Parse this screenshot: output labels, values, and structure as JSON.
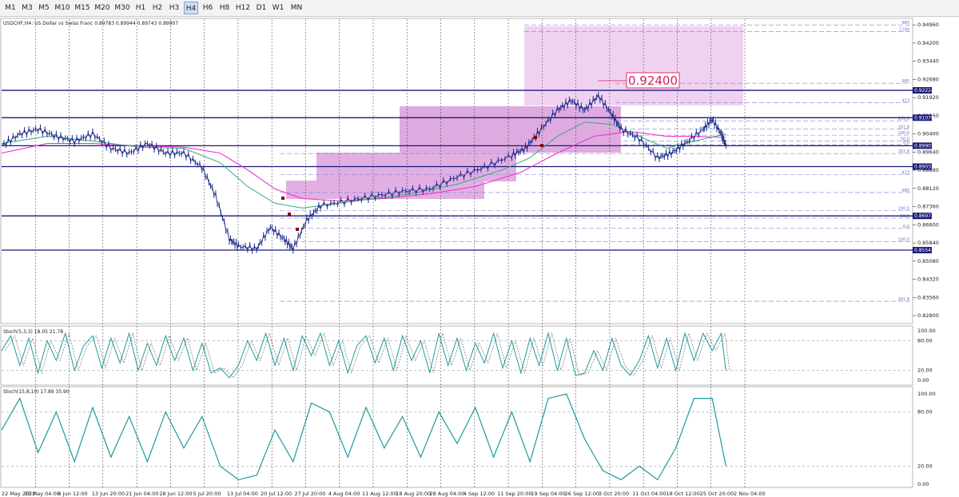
{
  "toolbar": {
    "timeframes": [
      "M1",
      "M3",
      "M5",
      "M10",
      "M15",
      "M20",
      "M30",
      "H1",
      "H2",
      "H3",
      "H4",
      "H6",
      "H8",
      "H12",
      "D1",
      "W1",
      "MN"
    ],
    "active": "H4"
  },
  "main_panel": {
    "header": "USDCHF,H4:  US Dollar vs Swiss Franc  0.89783 0.89944 0.89743 0.89907",
    "price_callout": "0.92400",
    "axis_labels": [
      "0.94960",
      "0.94200",
      "0.93440",
      "0.92680",
      "0.91920",
      "0.91160",
      "0.90400",
      "0.89640",
      "0.88880",
      "0.88120",
      "0.87360",
      "0.86600",
      "0.85840",
      "0.85080",
      "0.84320",
      "0.83560",
      "0.82800"
    ],
    "line_badges": [
      "0.92224",
      "0.91079",
      "0.89907",
      "0.89033",
      "0.86972",
      "0.85541"
    ],
    "fib_labels": [
      "685",
      "1100",
      "685",
      "423",
      "261.8",
      "161.8",
      "100.0",
      "50.0",
      "0.0",
      "261.8",
      "423",
      "685",
      "100.0",
      "50.0",
      "0.0",
      "100.0",
      "261.8"
    ]
  },
  "stoch1": {
    "header": "Stoch(5,3,3) 18.05 21.78",
    "axis_labels": [
      "100.00",
      "80.00",
      "20.00",
      "0.00"
    ]
  },
  "stoch2": {
    "header": "Stoch(15,8,10) 17.89 35.90",
    "axis_labels": [
      "100.00",
      "80.00",
      "20.00",
      "0.00"
    ]
  },
  "time_axis": [
    "22 May 2023",
    "30 May 04:00",
    "6 Jun 12:00",
    "13 Jun 20:00",
    "21 Jun 04:00",
    "28 Jun 12:00",
    "5 Jul 20:00",
    "13 Jul 04:00",
    "20 Jul 12:00",
    "27 Jul 20:00",
    "4 Aug 04:00",
    "11 Aug 12:00",
    "18 Aug 20:00",
    "28 Aug 04:00",
    "4 Sep 12:00",
    "11 Sep 20:00",
    "19 Sep 04:00",
    "26 Sep 12:00",
    "3 Oct 20:00",
    "11 Oct 04:00",
    "18 Oct 12:00",
    "25 Oct 20:00",
    "2 Nov 04:00"
  ],
  "chart_data": {
    "type": "line",
    "symbol": "USDCHF",
    "timeframe": "H4",
    "ohlc_last": {
      "open": 0.89783,
      "high": 0.89944,
      "low": 0.89743,
      "close": 0.89907
    },
    "ylim": [
      0.825,
      0.952
    ],
    "price_path": [
      [
        0.0,
        0.899
      ],
      [
        0.02,
        0.904
      ],
      [
        0.04,
        0.906
      ],
      [
        0.06,
        0.903
      ],
      [
        0.08,
        0.901
      ],
      [
        0.1,
        0.904
      ],
      [
        0.12,
        0.898
      ],
      [
        0.14,
        0.896
      ],
      [
        0.16,
        0.9
      ],
      [
        0.18,
        0.896
      ],
      [
        0.2,
        0.896
      ],
      [
        0.22,
        0.89
      ],
      [
        0.235,
        0.878
      ],
      [
        0.25,
        0.86
      ],
      [
        0.26,
        0.857
      ],
      [
        0.28,
        0.856
      ],
      [
        0.295,
        0.865
      ],
      [
        0.31,
        0.86
      ],
      [
        0.32,
        0.856
      ],
      [
        0.335,
        0.868
      ],
      [
        0.35,
        0.874
      ],
      [
        0.38,
        0.876
      ],
      [
        0.41,
        0.878
      ],
      [
        0.44,
        0.88
      ],
      [
        0.47,
        0.881
      ],
      [
        0.5,
        0.886
      ],
      [
        0.53,
        0.89
      ],
      [
        0.56,
        0.895
      ],
      [
        0.575,
        0.898
      ],
      [
        0.59,
        0.905
      ],
      [
        0.61,
        0.914
      ],
      [
        0.625,
        0.918
      ],
      [
        0.64,
        0.914
      ],
      [
        0.655,
        0.92
      ],
      [
        0.67,
        0.912
      ],
      [
        0.68,
        0.906
      ],
      [
        0.7,
        0.902
      ],
      [
        0.72,
        0.894
      ],
      [
        0.735,
        0.896
      ],
      [
        0.75,
        0.9
      ],
      [
        0.77,
        0.906
      ],
      [
        0.78,
        0.91
      ],
      [
        0.79,
        0.904
      ],
      [
        0.795,
        0.899
      ]
    ],
    "ma_fast_path": [
      [
        0.0,
        0.9
      ],
      [
        0.05,
        0.903
      ],
      [
        0.1,
        0.901
      ],
      [
        0.15,
        0.8985
      ],
      [
        0.2,
        0.898
      ],
      [
        0.24,
        0.892
      ],
      [
        0.27,
        0.882
      ],
      [
        0.3,
        0.875
      ],
      [
        0.33,
        0.873
      ],
      [
        0.36,
        0.8745
      ],
      [
        0.4,
        0.8765
      ],
      [
        0.45,
        0.879
      ],
      [
        0.5,
        0.883
      ],
      [
        0.55,
        0.889
      ],
      [
        0.58,
        0.894
      ],
      [
        0.61,
        0.903
      ],
      [
        0.64,
        0.909
      ],
      [
        0.67,
        0.908
      ],
      [
        0.7,
        0.903
      ],
      [
        0.73,
        0.898
      ],
      [
        0.76,
        0.901
      ],
      [
        0.795,
        0.904
      ]
    ],
    "ma_slow_path": [
      [
        0.0,
        0.896
      ],
      [
        0.05,
        0.9
      ],
      [
        0.1,
        0.9
      ],
      [
        0.15,
        0.899
      ],
      [
        0.2,
        0.8985
      ],
      [
        0.24,
        0.896
      ],
      [
        0.27,
        0.889
      ],
      [
        0.3,
        0.881
      ],
      [
        0.33,
        0.877
      ],
      [
        0.37,
        0.876
      ],
      [
        0.42,
        0.877
      ],
      [
        0.47,
        0.879
      ],
      [
        0.52,
        0.882
      ],
      [
        0.57,
        0.888
      ],
      [
        0.61,
        0.896
      ],
      [
        0.65,
        0.903
      ],
      [
        0.69,
        0.905
      ],
      [
        0.73,
        0.903
      ],
      [
        0.76,
        0.903
      ],
      [
        0.795,
        0.9025
      ]
    ],
    "horizontal_levels": [
      0.92224,
      0.91079,
      0.89907,
      0.89033,
      0.86972,
      0.85541
    ],
    "stoch1_path": [
      [
        0.0,
        60
      ],
      [
        0.01,
        90
      ],
      [
        0.02,
        30
      ],
      [
        0.03,
        85
      ],
      [
        0.04,
        15
      ],
      [
        0.05,
        80
      ],
      [
        0.06,
        40
      ],
      [
        0.07,
        95
      ],
      [
        0.08,
        20
      ],
      [
        0.09,
        70
      ],
      [
        0.1,
        90
      ],
      [
        0.11,
        25
      ],
      [
        0.12,
        85
      ],
      [
        0.13,
        35
      ],
      [
        0.14,
        95
      ],
      [
        0.15,
        20
      ],
      [
        0.16,
        75
      ],
      [
        0.17,
        30
      ],
      [
        0.18,
        90
      ],
      [
        0.19,
        40
      ],
      [
        0.2,
        85
      ],
      [
        0.21,
        20
      ],
      [
        0.22,
        75
      ],
      [
        0.23,
        15
      ],
      [
        0.24,
        25
      ],
      [
        0.25,
        5
      ],
      [
        0.26,
        30
      ],
      [
        0.27,
        80
      ],
      [
        0.28,
        40
      ],
      [
        0.29,
        95
      ],
      [
        0.3,
        30
      ],
      [
        0.31,
        85
      ],
      [
        0.32,
        20
      ],
      [
        0.33,
        90
      ],
      [
        0.34,
        50
      ],
      [
        0.35,
        95
      ],
      [
        0.36,
        30
      ],
      [
        0.37,
        80
      ],
      [
        0.38,
        15
      ],
      [
        0.39,
        70
      ],
      [
        0.4,
        90
      ],
      [
        0.41,
        35
      ],
      [
        0.42,
        85
      ],
      [
        0.43,
        20
      ],
      [
        0.44,
        90
      ],
      [
        0.45,
        40
      ],
      [
        0.46,
        80
      ],
      [
        0.47,
        15
      ],
      [
        0.48,
        95
      ],
      [
        0.49,
        30
      ],
      [
        0.5,
        85
      ],
      [
        0.51,
        20
      ],
      [
        0.52,
        75
      ],
      [
        0.53,
        35
      ],
      [
        0.54,
        95
      ],
      [
        0.55,
        25
      ],
      [
        0.56,
        80
      ],
      [
        0.57,
        15
      ],
      [
        0.58,
        85
      ],
      [
        0.59,
        30
      ],
      [
        0.6,
        95
      ],
      [
        0.61,
        20
      ],
      [
        0.62,
        85
      ],
      [
        0.63,
        10
      ],
      [
        0.64,
        15
      ],
      [
        0.65,
        60
      ],
      [
        0.66,
        20
      ],
      [
        0.67,
        85
      ],
      [
        0.68,
        30
      ],
      [
        0.69,
        10
      ],
      [
        0.7,
        40
      ],
      [
        0.71,
        90
      ],
      [
        0.72,
        25
      ],
      [
        0.73,
        85
      ],
      [
        0.74,
        20
      ],
      [
        0.75,
        95
      ],
      [
        0.76,
        40
      ],
      [
        0.77,
        95
      ],
      [
        0.78,
        60
      ],
      [
        0.79,
        95
      ],
      [
        0.795,
        20
      ]
    ],
    "stoch2_path": [
      [
        0.0,
        60
      ],
      [
        0.02,
        95
      ],
      [
        0.04,
        35
      ],
      [
        0.06,
        80
      ],
      [
        0.08,
        25
      ],
      [
        0.1,
        85
      ],
      [
        0.12,
        30
      ],
      [
        0.14,
        75
      ],
      [
        0.16,
        25
      ],
      [
        0.18,
        80
      ],
      [
        0.2,
        40
      ],
      [
        0.22,
        75
      ],
      [
        0.24,
        20
      ],
      [
        0.26,
        5
      ],
      [
        0.28,
        10
      ],
      [
        0.3,
        60
      ],
      [
        0.32,
        25
      ],
      [
        0.34,
        90
      ],
      [
        0.36,
        80
      ],
      [
        0.38,
        30
      ],
      [
        0.4,
        85
      ],
      [
        0.42,
        40
      ],
      [
        0.44,
        75
      ],
      [
        0.46,
        30
      ],
      [
        0.48,
        80
      ],
      [
        0.5,
        45
      ],
      [
        0.52,
        85
      ],
      [
        0.54,
        30
      ],
      [
        0.56,
        80
      ],
      [
        0.58,
        25
      ],
      [
        0.6,
        95
      ],
      [
        0.62,
        100
      ],
      [
        0.64,
        50
      ],
      [
        0.66,
        15
      ],
      [
        0.68,
        5
      ],
      [
        0.7,
        20
      ],
      [
        0.72,
        5
      ],
      [
        0.74,
        40
      ],
      [
        0.76,
        95
      ],
      [
        0.78,
        95
      ],
      [
        0.795,
        20
      ]
    ],
    "stoch_levels": [
      80,
      20
    ]
  },
  "colors": {
    "candles": "#1a2a8a",
    "ma_fast": "#33aa77",
    "ma_slow": "#ee33cc",
    "level_line": "#1a1a7a",
    "badge_bg": "#1a1a7a",
    "zone_fill": "#d68fd6",
    "callout": "#d81b60",
    "stoch_main": "#1f9a9a",
    "grid": "#444444",
    "fib": "#7f7fe0"
  }
}
